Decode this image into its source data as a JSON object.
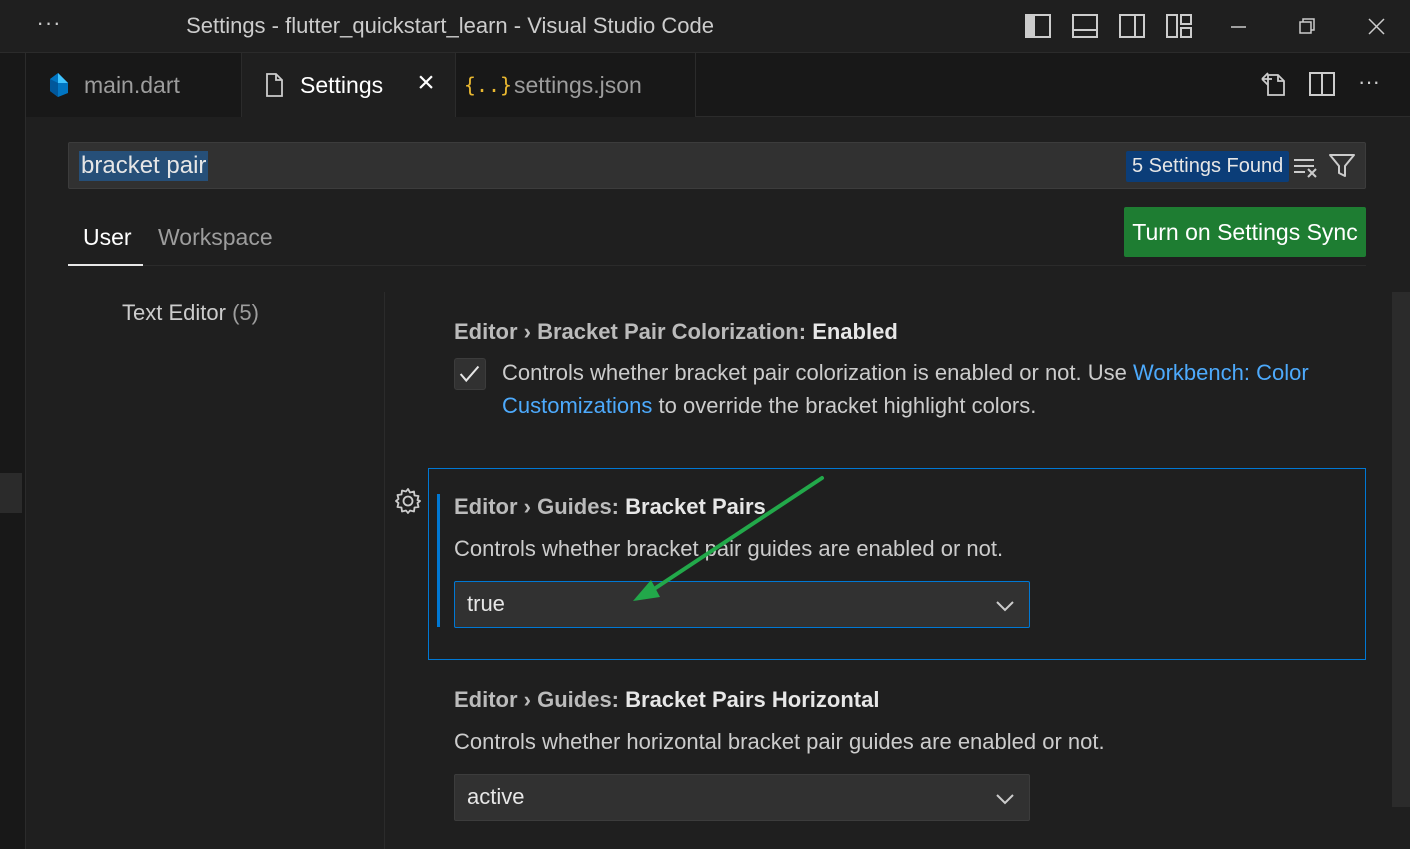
{
  "window": {
    "title": "Settings - flutter_quickstart_learn - Visual Studio Code"
  },
  "tabs": [
    {
      "label": "main.dart",
      "icon": "dart-icon",
      "active": false
    },
    {
      "label": "Settings",
      "icon": "file-icon",
      "active": true
    },
    {
      "label": "settings.json",
      "icon": "json-icon",
      "active": false
    }
  ],
  "search": {
    "query": "bracket pair",
    "results_badge": "5 Settings Found"
  },
  "scope_tabs": [
    "User",
    "Workspace"
  ],
  "sync_button": "Turn on Settings Sync",
  "toc": {
    "item_label": "Text Editor",
    "item_count": "(5)"
  },
  "settings": [
    {
      "category": "Editor › ",
      "name_prefix": "Bracket Pair Colorization: ",
      "name": "Enabled",
      "checked": true,
      "desc_before": "Controls whether bracket pair colorization is enabled or not. Use ",
      "link": "Workbench: Color Customizations",
      "desc_after": " to override the bracket highlight colors."
    },
    {
      "category": "Editor › ",
      "name_prefix": "Guides: ",
      "name": "Bracket Pairs",
      "description": "Controls whether bracket pair guides are enabled or not.",
      "value": "true"
    },
    {
      "category": "Editor › ",
      "name_prefix": "Guides: ",
      "name": "Bracket Pairs Horizontal",
      "description": "Controls whether horizontal bracket pair guides are enabled or not.",
      "value": "active"
    }
  ],
  "colors": {
    "accent": "#0078d4",
    "sync_button": "#1e7d32",
    "link": "#4daafc",
    "annotation_arrow": "#22a84a"
  }
}
